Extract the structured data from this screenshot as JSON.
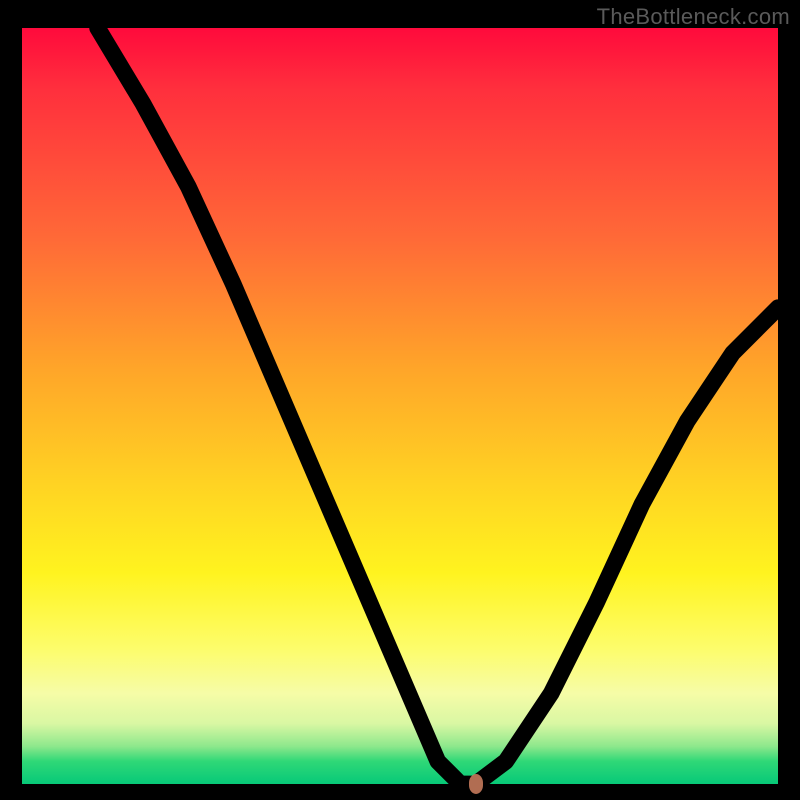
{
  "watermark": {
    "text": "TheBottleneck.com"
  },
  "chart_data": {
    "type": "line",
    "title": "",
    "xlabel": "",
    "ylabel": "",
    "xlim": [
      0,
      100
    ],
    "ylim": [
      0,
      100
    ],
    "grid": false,
    "legend": false,
    "series": [
      {
        "name": "bottleneck-curve",
        "x": [
          10,
          16,
          22,
          28,
          34,
          40,
          46,
          52,
          55,
          58,
          60,
          64,
          70,
          76,
          82,
          88,
          94,
          100
        ],
        "y": [
          100,
          90,
          79,
          66,
          52,
          38,
          24,
          10,
          3,
          0,
          0,
          3,
          12,
          24,
          37,
          48,
          57,
          63
        ]
      }
    ],
    "marker": {
      "x": 60,
      "y": 0,
      "color": "#d08060"
    },
    "background_gradient": {
      "direction": "vertical",
      "stops": [
        {
          "pos": 0.0,
          "color": "#ff0a3c"
        },
        {
          "pos": 0.45,
          "color": "#ffa529"
        },
        {
          "pos": 0.72,
          "color": "#fff31f"
        },
        {
          "pos": 0.92,
          "color": "#d9f7a3"
        },
        {
          "pos": 1.0,
          "color": "#07c978"
        }
      ]
    }
  }
}
